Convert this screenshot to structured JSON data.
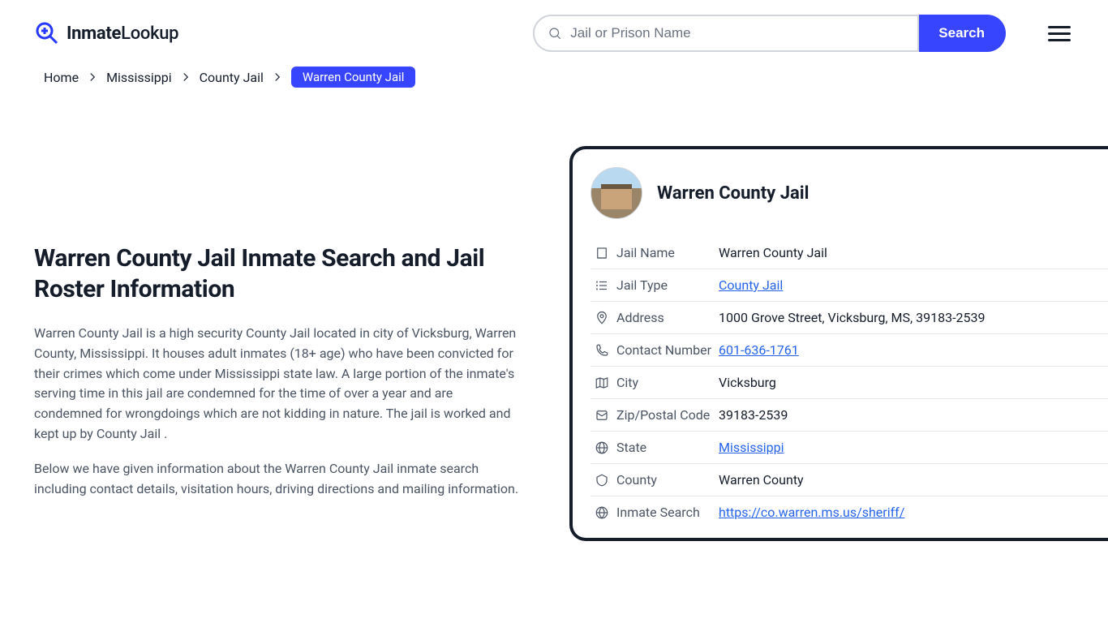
{
  "header": {
    "logo_text_bold": "Inmate",
    "logo_text_light": "Lookup",
    "search_placeholder": "Jail or Prison Name",
    "search_button": "Search"
  },
  "breadcrumb": {
    "items": [
      "Home",
      "Mississippi",
      "County Jail"
    ],
    "current": "Warren County Jail"
  },
  "page": {
    "title": "Warren County Jail Inmate Search and Jail Roster Information",
    "p1": "Warren County Jail is a high security County Jail located in city of Vicksburg, Warren County, Mississippi. It houses adult inmates (18+ age) who have been convicted for their crimes which come under Mississippi state law. A large portion of the inmate's serving time in this jail are condemned for the time of over a year and are condemned for wrongdoings which are not kidding in nature. The jail is worked and kept up by County Jail .",
    "p2": "Below we have given information about the Warren County Jail inmate search including contact details, visitation hours, driving directions and mailing information."
  },
  "card": {
    "title": "Warren County Jail",
    "rows": [
      {
        "icon": "building",
        "label": "Jail Name",
        "value": "Warren County Jail",
        "link": false
      },
      {
        "icon": "list",
        "label": "Jail Type",
        "value": "County Jail",
        "link": true
      },
      {
        "icon": "pin",
        "label": "Address",
        "value": "1000 Grove Street, Vicksburg, MS, 39183-2539",
        "link": false
      },
      {
        "icon": "phone",
        "label": "Contact Number",
        "value": "601-636-1761",
        "link": true
      },
      {
        "icon": "map",
        "label": "City",
        "value": "Vicksburg",
        "link": false
      },
      {
        "icon": "mail",
        "label": "Zip/Postal Code",
        "value": "39183-2539",
        "link": false
      },
      {
        "icon": "globe",
        "label": "State",
        "value": "Mississippi",
        "link": true
      },
      {
        "icon": "badge",
        "label": "County",
        "value": "Warren County",
        "link": false
      },
      {
        "icon": "web",
        "label": "Inmate Search",
        "value": "https://co.warren.ms.us/sheriff/",
        "link": true
      }
    ]
  }
}
